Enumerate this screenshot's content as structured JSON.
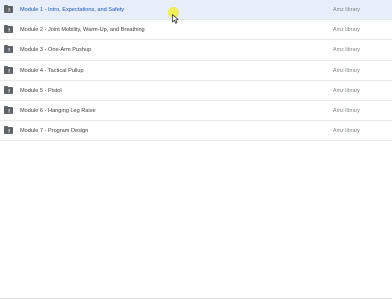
{
  "files": [
    {
      "name": "Module 1 - Intro, Expectations, and Safety",
      "owner": "Amz library",
      "selected": true
    },
    {
      "name": "Module 2 - Joint Mobility, Warm-Up, and Breathing",
      "owner": "Amz library"
    },
    {
      "name": "Module 3 - One-Arm Pushup",
      "owner": "Amz library"
    },
    {
      "name": "Module 4 - Tactical Pullup",
      "owner": "Amz library"
    },
    {
      "name": "Module 5 - Pistol",
      "owner": "Amz library"
    },
    {
      "name": "Module 6 - Hanging Leg Raise",
      "owner": "Amz library"
    },
    {
      "name": "Module 7 - Program Design",
      "owner": "Amz library"
    }
  ],
  "colors": {
    "selected_row_bg": "#e8eefb",
    "selected_text": "#1a56c4",
    "folder_icon": "#5f6368",
    "cursor_highlight": "#f0ec3c"
  },
  "icons": {
    "folder": "shared-folder-icon",
    "cursor": "mouse-cursor-icon"
  }
}
